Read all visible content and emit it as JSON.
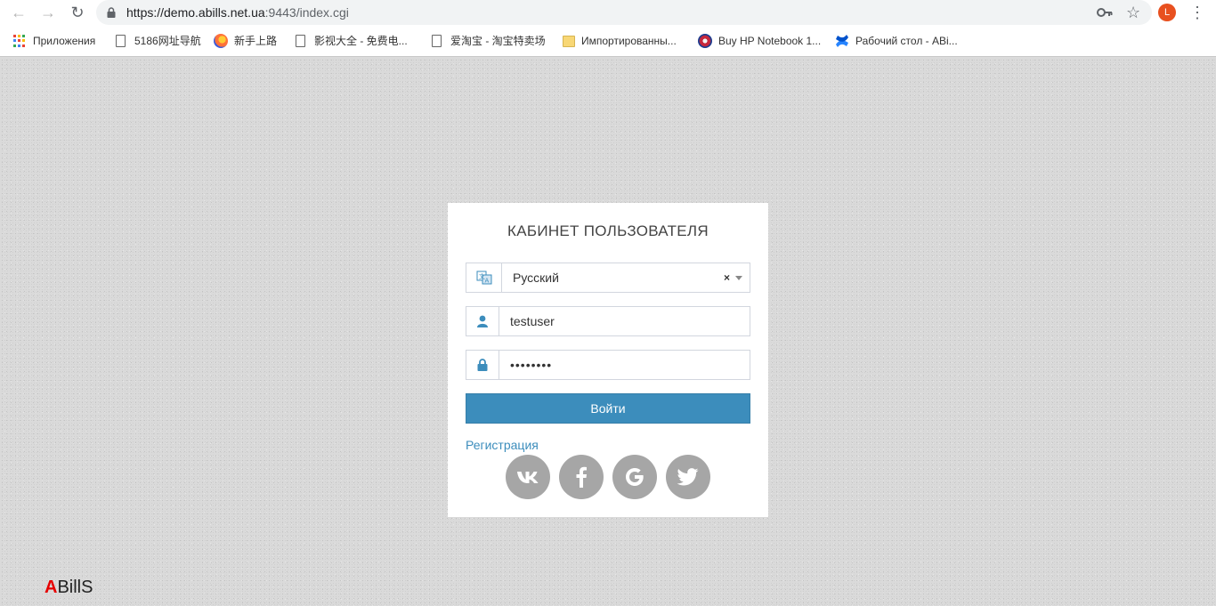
{
  "browser": {
    "url_main": "https://demo.abills.net.ua",
    "url_rest": ":9443/index.cgi",
    "avatar_letter": "L",
    "bookmarks": [
      {
        "label": "Приложения",
        "icon": "apps-grid-icon"
      },
      {
        "label": "5186网址导航",
        "icon": "page-icon"
      },
      {
        "label": "新手上路",
        "icon": "firefox-icon"
      },
      {
        "label": "影视大全 - 免费电...",
        "icon": "page-icon"
      },
      {
        "label": "爱淘宝 - 淘宝特卖场",
        "icon": "page-icon"
      },
      {
        "label": "Импортированны...",
        "icon": "folder-icon"
      },
      {
        "label": "Buy HP Notebook 1...",
        "icon": "hp-icon"
      },
      {
        "label": "Рабочий стол - ABi...",
        "icon": "confluence-icon"
      }
    ]
  },
  "login": {
    "title": "КАБИНЕТ ПОЛЬЗОВАТЕЛЯ",
    "language_value": "Русский",
    "username_value": "testuser",
    "password_value": "••••••••",
    "submit_label": "Войти",
    "register_label": "Регистрация",
    "social": [
      "vk",
      "facebook",
      "google",
      "twitter"
    ]
  },
  "footer": {
    "brand_first": "A",
    "brand_rest": "BillS"
  },
  "colors": {
    "primary": "#3c8dbc",
    "social_bg": "#a6a6a6",
    "brand_red": "#e60000"
  }
}
